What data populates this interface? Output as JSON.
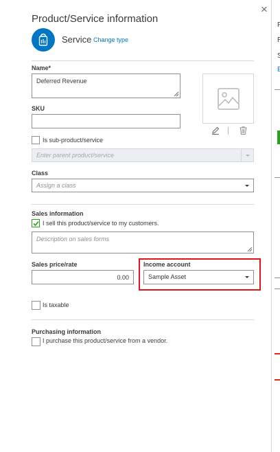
{
  "panel": {
    "title": "Product/Service information",
    "close_glyph": "×",
    "type_icon": "service-bag-icon",
    "type_name": "Service",
    "change_type_link": "Change type"
  },
  "name_field": {
    "label": "Name*",
    "value": "Deferred Revenue"
  },
  "sku_field": {
    "label": "SKU",
    "value": ""
  },
  "image_upload": {
    "placeholder_icon": "image-placeholder-icon",
    "edit_icon": "pencil-icon",
    "delete_icon": "trash-icon"
  },
  "sub_product": {
    "checkbox_label": "Is sub-product/service",
    "checked": false,
    "parent_placeholder": "Enter parent product/service"
  },
  "class_field": {
    "label": "Class",
    "placeholder": "Assign a class"
  },
  "sales": {
    "section_label": "Sales information",
    "sell_checkbox_label": "I sell this product/service to my customers.",
    "sell_checked": true,
    "description_placeholder": "Description on sales forms",
    "rate_label": "Sales price/rate",
    "rate_value": "0.00",
    "income_account_label": "Income account",
    "income_account_value": "Sample Asset"
  },
  "taxable": {
    "checkbox_label": "Is taxable",
    "checked": false
  },
  "purchasing": {
    "section_label": "Purchasing information",
    "purchase_checkbox_label": "I purchase this product/service from a vendor.",
    "purchase_checked": false
  },
  "background_page": {
    "letters": [
      "F",
      "R",
      "S",
      "E"
    ]
  },
  "colors": {
    "accent_blue": "#0077c5",
    "success_green": "#2ca01c",
    "highlight_red": "#e0131b"
  }
}
